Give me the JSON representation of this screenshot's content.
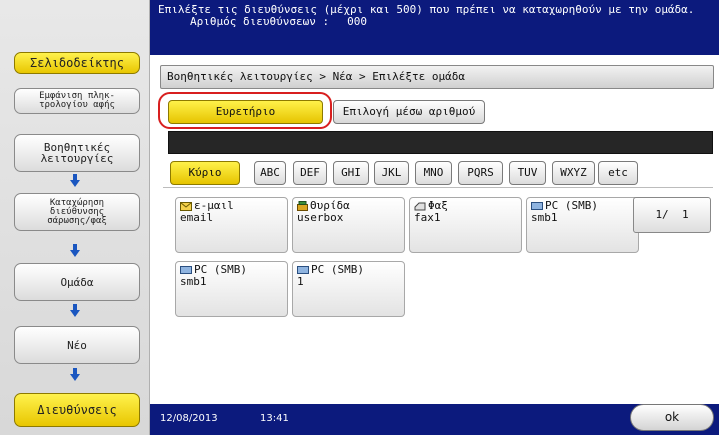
{
  "header": {
    "instruction": "Επιλέξτε τις διευθύνσεις (μέχρι και 500) που πρέπει να καταχωρηθούν με την ομάδα.",
    "count_label": "Αριθμός διευθύνσεων :",
    "count_value": "000"
  },
  "sidebar": {
    "bookmark": "Σελιδοδείκτης",
    "keyboard_display": "Εμφάνιση πληκ-\nτρολογίου αφής",
    "items": [
      {
        "label": "Βοηθητικές\nλειτουργίες"
      },
      {
        "label": "Καταχώρηση\nδιεύθυνσης\nσάρωσης/φαξ"
      },
      {
        "label": "Ομάδα"
      },
      {
        "label": "Νέο"
      },
      {
        "label": "Διευθύνσεις"
      }
    ]
  },
  "breadcrumb": "Βοηθητικές λειτουργίες > Νέα > Επιλέξτε ομάδα",
  "tabs": {
    "index": "Ευρετήριο",
    "by_number": "Επιλογή μέσω αριθμού"
  },
  "index_keys": [
    "Κύριο",
    "ABC",
    "DEF",
    "GHI",
    "JKL",
    "MNO",
    "PQRS",
    "TUV",
    "WXYZ",
    "etc"
  ],
  "address_cards": [
    {
      "type": "ε-μαιl",
      "name": "email",
      "icon": "email-icon"
    },
    {
      "type": "Θυρίδα",
      "name": "userbox",
      "icon": "box-icon"
    },
    {
      "type": "Φαξ",
      "name": "fax1",
      "icon": "fax-icon"
    },
    {
      "type": "PC (SMB)",
      "name": "smb1",
      "icon": "pc-icon"
    },
    {
      "type": "PC (SMB)",
      "name": "smb1",
      "icon": "pc-icon"
    },
    {
      "type": "PC (SMB)",
      "name": "1",
      "icon": "pc-icon"
    }
  ],
  "pager": {
    "current": "1/",
    "total": "1"
  },
  "footer": {
    "date": "12/08/2013",
    "time": "13:41",
    "ok": "ok"
  },
  "colors": {
    "header_bg": "#0c1a7d",
    "selected": "#f0d800",
    "highlight_ring": "#d81f1f",
    "arrow": "#1a56c0"
  }
}
